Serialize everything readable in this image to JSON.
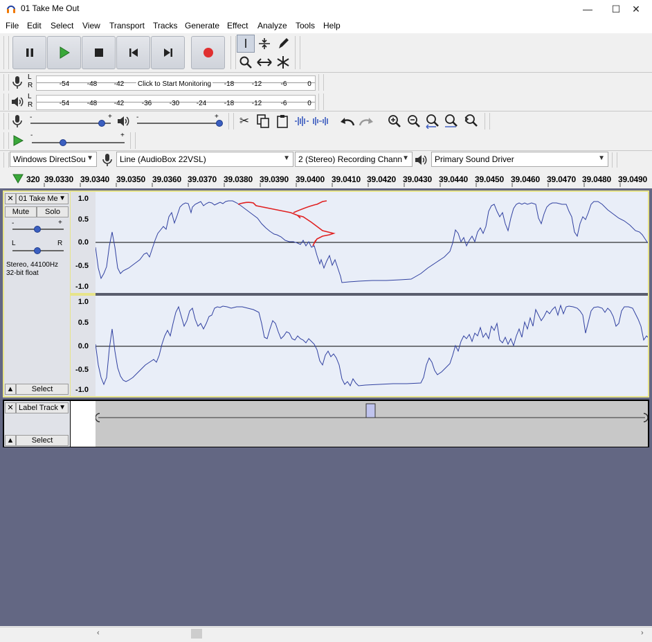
{
  "window": {
    "title": "01 Take Me Out",
    "minimize": "—",
    "maximize": "☐",
    "close": "✕"
  },
  "menu": [
    "File",
    "Edit",
    "Select",
    "View",
    "Transport",
    "Tracks",
    "Generate",
    "Effect",
    "Analyze",
    "Tools",
    "Help"
  ],
  "meters": {
    "record_ticks": [
      "-54",
      "-48",
      "-42",
      "-18",
      "-12",
      "-6",
      "0"
    ],
    "record_prompt": "Click to Start Monitoring",
    "play_ticks": [
      "-54",
      "-48",
      "-42",
      "-36",
      "-30",
      "-24",
      "-18",
      "-12",
      "-6",
      "0"
    ],
    "l": "L",
    "r": "R"
  },
  "mixer": {
    "minus": "-",
    "plus": "+"
  },
  "devices": {
    "host": "Windows DirectSou",
    "recording_device": "Line (AudioBox 22VSL)",
    "channels": "2 (Stereo) Recording Chann",
    "playback_device": "Primary Sound Driver"
  },
  "ruler": [
    "320",
    "39.0330",
    "39.0340",
    "39.0350",
    "39.0360",
    "39.0370",
    "39.0380",
    "39.0390",
    "39.0400",
    "39.0410",
    "39.0420",
    "39.0430",
    "39.0440",
    "39.0450",
    "39.0460",
    "39.0470",
    "39.0480",
    "39.0490"
  ],
  "audio_track": {
    "name": "01 Take Me",
    "mute": "Mute",
    "solo": "Solo",
    "pan_l": "L",
    "pan_r": "R",
    "info_line1": "Stereo, 44100Hz",
    "info_line2": "32-bit float",
    "select": "Select",
    "axis": [
      "1.0",
      "0.5",
      "0.0",
      "-0.5",
      "-1.0"
    ]
  },
  "label_track": {
    "name": "Label Track",
    "select": "Select"
  },
  "colors": {
    "waveform": "#3040a0",
    "wave_bg": "#e9eef8",
    "annotation": "#e02020",
    "track_border": "#e7e48a",
    "background": "#636783"
  }
}
